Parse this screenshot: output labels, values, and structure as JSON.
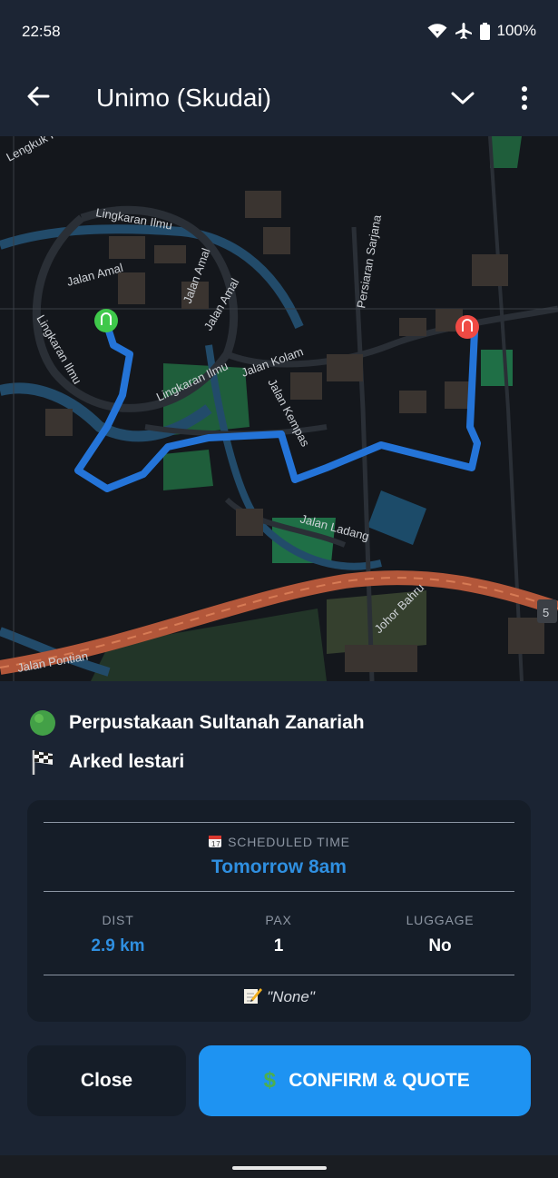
{
  "status_bar": {
    "time": "22:58",
    "battery": "100%",
    "icons": [
      "wifi-icon",
      "airplane-mode-icon",
      "battery-icon"
    ]
  },
  "app_bar": {
    "title": "Unimo (Skudai)",
    "back_icon": "arrow-left-icon",
    "expand_icon": "chevron-down-icon",
    "menu_icon": "more-vertical-icon"
  },
  "map": {
    "labels": {
      "lingkuk_resak": "Lengkuk Resak",
      "lingkaran_ilmu_top": "Lingkaran Ilmu",
      "lingkaran_ilmu_left": "Lingkaran Ilmu",
      "lingkaran_ilmu_mid": "Lingkaran Ilmu",
      "jalan_amal_1": "Jalan Amal",
      "jalan_amal_2": "Jalan Amal",
      "jalan_amal_3": "Jalan Amal",
      "jalan_kolam": "Jalan Kolam",
      "jalan_kempas": "Jalan Kempas",
      "jalan_ladang": "Jalan Ladang",
      "persiaran_sarjana": "Persiaran Sarjana",
      "jalan_pontian": "Jalan Pontian",
      "johor_bahru": "Johor Bahru",
      "route_shield": "5"
    },
    "colors": {
      "route": "#2474d8",
      "start_marker": "#3fc84a",
      "end_marker": "#ef4a44",
      "highway": "#b3573a",
      "water": "#224b6a",
      "park": "#1f6f46"
    }
  },
  "trip": {
    "origin": "Perpustakaan Sultanah Zanariah",
    "origin_icon": "green-circle-icon",
    "destination": "Arked lestari",
    "destination_icon": "checkered-flag-icon"
  },
  "details": {
    "scheduled_label": "SCHEDULED TIME",
    "scheduled_icon": "calendar-icon",
    "scheduled_value": "Tomorrow 8am",
    "dist_label": "DIST",
    "dist_value": "2.9 km",
    "pax_label": "PAX",
    "pax_value": "1",
    "luggage_label": "LUGGAGE",
    "luggage_value": "No",
    "notes_icon": "memo-icon",
    "notes": "\"None\""
  },
  "actions": {
    "close_label": "Close",
    "confirm_label": "CONFIRM & QUOTE",
    "confirm_icon": "dollar-icon",
    "accent": "#1e93f2"
  }
}
